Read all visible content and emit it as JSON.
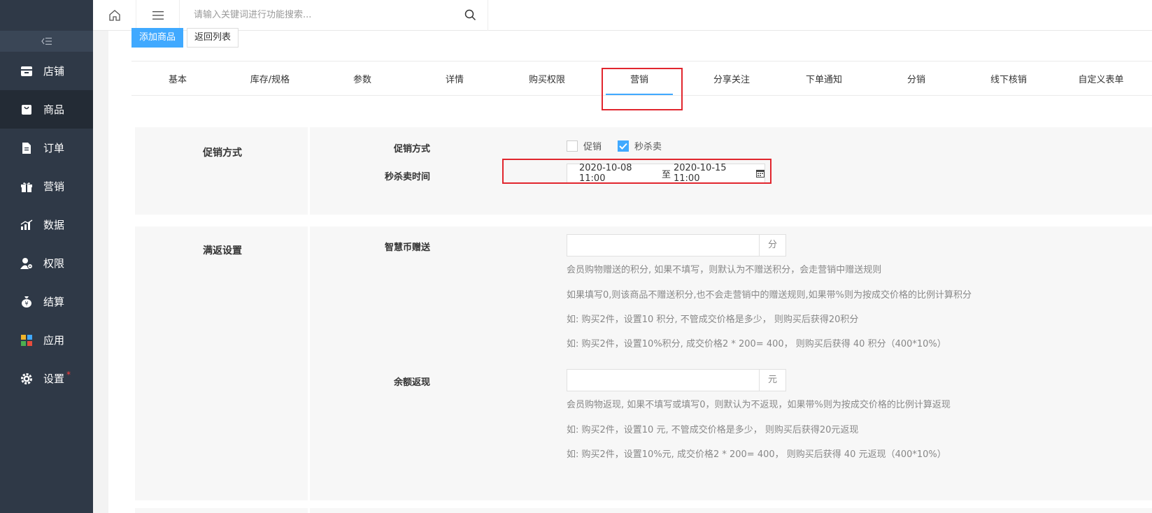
{
  "sidebar": {
    "collapse_icon": "collapse-icon",
    "items": [
      {
        "label": "店铺",
        "icon": "store-icon"
      },
      {
        "label": "商品",
        "icon": "bag-icon"
      },
      {
        "label": "订单",
        "icon": "document-icon"
      },
      {
        "label": "营销",
        "icon": "gift-icon"
      },
      {
        "label": "数据",
        "icon": "chart-icon"
      },
      {
        "label": "权限",
        "icon": "user-lock-icon"
      },
      {
        "label": "结算",
        "icon": "money-bag-icon"
      },
      {
        "label": "应用",
        "icon": "apps-icon"
      },
      {
        "label": "设置",
        "icon": "gear-icon",
        "badge": "*"
      }
    ]
  },
  "header": {
    "search_placeholder": "请输入关键词进行功能搜索..."
  },
  "toolbar": {
    "add_label": "添加商品",
    "back_label": "返回列表"
  },
  "tabs": [
    "基本",
    "库存/规格",
    "参数",
    "详情",
    "购买权限",
    "营销",
    "分享关注",
    "下单通知",
    "分销",
    "线下核销",
    "自定义表单"
  ],
  "promo": {
    "section_title": "促销方式",
    "method_label": "促销方式",
    "opt_promo": "促销",
    "opt_seckill": "秒杀卖",
    "time_label": "秒杀卖时间",
    "start": "2020-10-08 11:00",
    "to": "至",
    "end": "2020-10-15 11:00"
  },
  "rebate": {
    "section_title": "满返设置",
    "coin_label": "智慧币赠送",
    "coin_unit": "分",
    "coin_hints": [
      "会员购物赠送的积分, 如果不填写，则默认为不赠送积分，会走营销中赠送规则",
      "如果填写0,则该商品不赠送积分,也不会走营销中的赠送规则,如果带%则为按成交价格的比例计算积分",
      "如: 购买2件，设置10 积分, 不管成交价格是多少， 则购买后获得20积分",
      "如: 购买2件，设置10%积分, 成交价格2 * 200= 400， 则购买后获得 40 积分（400*10%）"
    ],
    "balance_label": "余额返现",
    "balance_unit": "元",
    "balance_hints": [
      "会员购物返现, 如果不填写或填写0，则默认为不返现，如果带%则为按成交价格的比例计算返现",
      "如: 购买2件，设置10 元, 不管成交价格是多少， 则购买后获得20元返现",
      "如: 购买2件，设置10%元, 成交价格2 * 200= 400， 则购买后获得 40 元返现（400*10%）"
    ]
  },
  "colors": {
    "sidebar_bg": "#2f3947",
    "sidebar_active": "#232b35",
    "primary": "#40a9ff",
    "highlight": "#e1262e"
  }
}
